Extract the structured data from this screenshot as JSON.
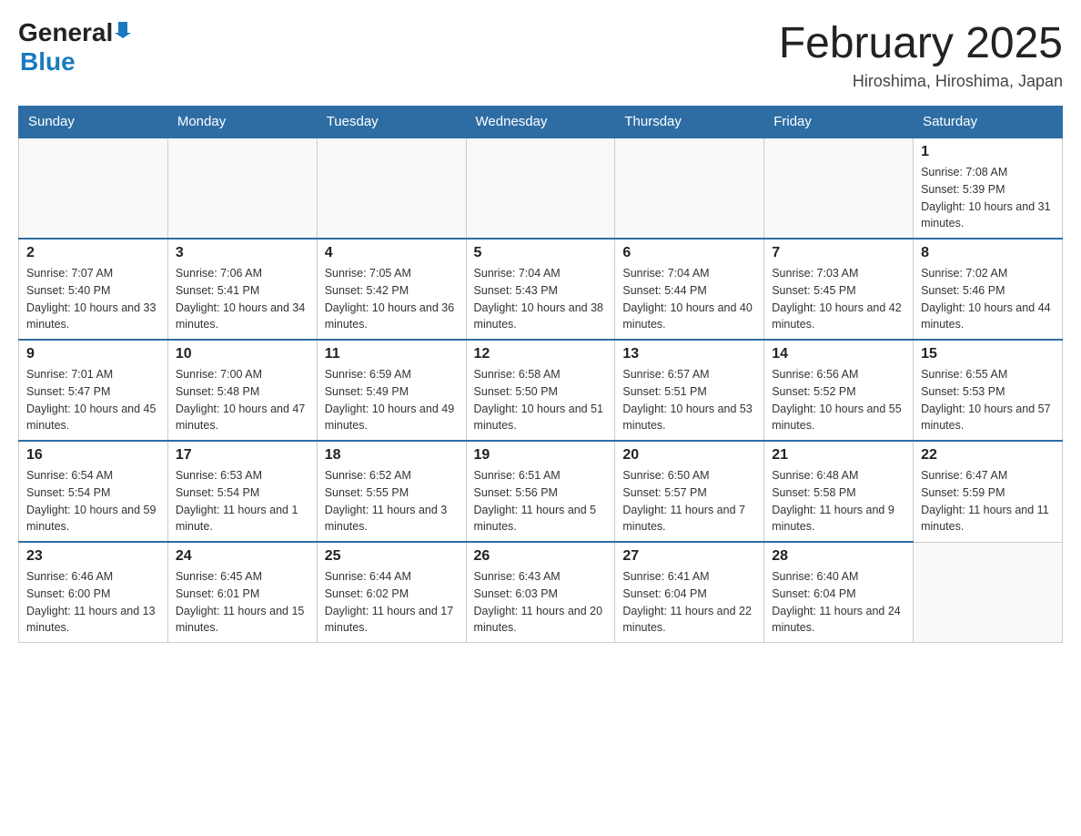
{
  "header": {
    "logo_general": "General",
    "logo_blue": "Blue",
    "month_title": "February 2025",
    "location": "Hiroshima, Hiroshima, Japan"
  },
  "days_of_week": [
    "Sunday",
    "Monday",
    "Tuesday",
    "Wednesday",
    "Thursday",
    "Friday",
    "Saturday"
  ],
  "weeks": [
    [
      {
        "day": "",
        "info": ""
      },
      {
        "day": "",
        "info": ""
      },
      {
        "day": "",
        "info": ""
      },
      {
        "day": "",
        "info": ""
      },
      {
        "day": "",
        "info": ""
      },
      {
        "day": "",
        "info": ""
      },
      {
        "day": "1",
        "info": "Sunrise: 7:08 AM\nSunset: 5:39 PM\nDaylight: 10 hours and 31 minutes."
      }
    ],
    [
      {
        "day": "2",
        "info": "Sunrise: 7:07 AM\nSunset: 5:40 PM\nDaylight: 10 hours and 33 minutes."
      },
      {
        "day": "3",
        "info": "Sunrise: 7:06 AM\nSunset: 5:41 PM\nDaylight: 10 hours and 34 minutes."
      },
      {
        "day": "4",
        "info": "Sunrise: 7:05 AM\nSunset: 5:42 PM\nDaylight: 10 hours and 36 minutes."
      },
      {
        "day": "5",
        "info": "Sunrise: 7:04 AM\nSunset: 5:43 PM\nDaylight: 10 hours and 38 minutes."
      },
      {
        "day": "6",
        "info": "Sunrise: 7:04 AM\nSunset: 5:44 PM\nDaylight: 10 hours and 40 minutes."
      },
      {
        "day": "7",
        "info": "Sunrise: 7:03 AM\nSunset: 5:45 PM\nDaylight: 10 hours and 42 minutes."
      },
      {
        "day": "8",
        "info": "Sunrise: 7:02 AM\nSunset: 5:46 PM\nDaylight: 10 hours and 44 minutes."
      }
    ],
    [
      {
        "day": "9",
        "info": "Sunrise: 7:01 AM\nSunset: 5:47 PM\nDaylight: 10 hours and 45 minutes."
      },
      {
        "day": "10",
        "info": "Sunrise: 7:00 AM\nSunset: 5:48 PM\nDaylight: 10 hours and 47 minutes."
      },
      {
        "day": "11",
        "info": "Sunrise: 6:59 AM\nSunset: 5:49 PM\nDaylight: 10 hours and 49 minutes."
      },
      {
        "day": "12",
        "info": "Sunrise: 6:58 AM\nSunset: 5:50 PM\nDaylight: 10 hours and 51 minutes."
      },
      {
        "day": "13",
        "info": "Sunrise: 6:57 AM\nSunset: 5:51 PM\nDaylight: 10 hours and 53 minutes."
      },
      {
        "day": "14",
        "info": "Sunrise: 6:56 AM\nSunset: 5:52 PM\nDaylight: 10 hours and 55 minutes."
      },
      {
        "day": "15",
        "info": "Sunrise: 6:55 AM\nSunset: 5:53 PM\nDaylight: 10 hours and 57 minutes."
      }
    ],
    [
      {
        "day": "16",
        "info": "Sunrise: 6:54 AM\nSunset: 5:54 PM\nDaylight: 10 hours and 59 minutes."
      },
      {
        "day": "17",
        "info": "Sunrise: 6:53 AM\nSunset: 5:54 PM\nDaylight: 11 hours and 1 minute."
      },
      {
        "day": "18",
        "info": "Sunrise: 6:52 AM\nSunset: 5:55 PM\nDaylight: 11 hours and 3 minutes."
      },
      {
        "day": "19",
        "info": "Sunrise: 6:51 AM\nSunset: 5:56 PM\nDaylight: 11 hours and 5 minutes."
      },
      {
        "day": "20",
        "info": "Sunrise: 6:50 AM\nSunset: 5:57 PM\nDaylight: 11 hours and 7 minutes."
      },
      {
        "day": "21",
        "info": "Sunrise: 6:48 AM\nSunset: 5:58 PM\nDaylight: 11 hours and 9 minutes."
      },
      {
        "day": "22",
        "info": "Sunrise: 6:47 AM\nSunset: 5:59 PM\nDaylight: 11 hours and 11 minutes."
      }
    ],
    [
      {
        "day": "23",
        "info": "Sunrise: 6:46 AM\nSunset: 6:00 PM\nDaylight: 11 hours and 13 minutes."
      },
      {
        "day": "24",
        "info": "Sunrise: 6:45 AM\nSunset: 6:01 PM\nDaylight: 11 hours and 15 minutes."
      },
      {
        "day": "25",
        "info": "Sunrise: 6:44 AM\nSunset: 6:02 PM\nDaylight: 11 hours and 17 minutes."
      },
      {
        "day": "26",
        "info": "Sunrise: 6:43 AM\nSunset: 6:03 PM\nDaylight: 11 hours and 20 minutes."
      },
      {
        "day": "27",
        "info": "Sunrise: 6:41 AM\nSunset: 6:04 PM\nDaylight: 11 hours and 22 minutes."
      },
      {
        "day": "28",
        "info": "Sunrise: 6:40 AM\nSunset: 6:04 PM\nDaylight: 11 hours and 24 minutes."
      },
      {
        "day": "",
        "info": ""
      }
    ]
  ]
}
